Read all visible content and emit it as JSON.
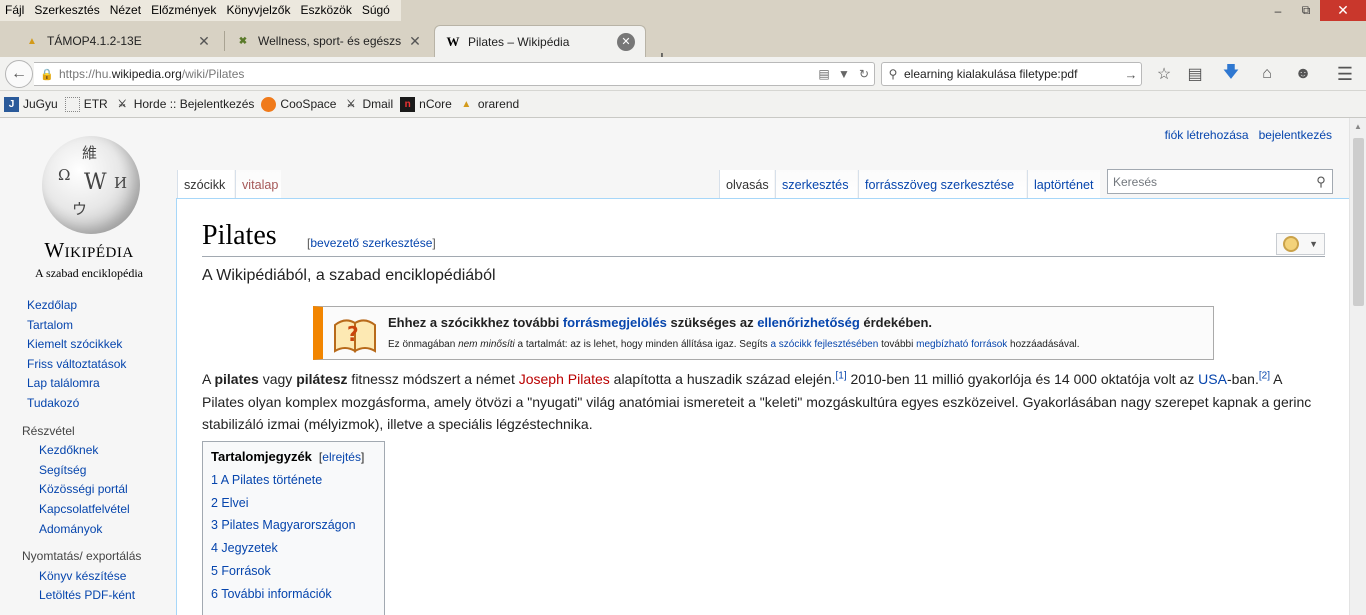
{
  "menubar": {
    "items": [
      "Fájl",
      "Szerkesztés",
      "Nézet",
      "Előzmények",
      "Könyvjelzők",
      "Eszközök",
      "Súgó"
    ]
  },
  "tabs": [
    {
      "title": "TÁMOP4.1.2-13E",
      "icon": "pma-favicon"
    },
    {
      "title": "Wellness, sport- és egészs...",
      "icon": "wellness-favicon"
    },
    {
      "title": "Pilates – Wikipédia",
      "icon": "wikipedia-favicon"
    }
  ],
  "navbar": {
    "url_prefix": "https://hu.",
    "url_domain": "wikipedia.org",
    "url_path": "/wiki/Pilates",
    "search_value": "elearning kialakulása filetype:pdf"
  },
  "bookmarks": [
    "JuGyu",
    "ETR",
    "Horde :: Bejelentkezés",
    "CooSpace",
    "Dmail",
    "nCore",
    "orarend"
  ],
  "logo": {
    "wordmark": "Wikipédia",
    "tagline": "A szabad enciklopédia",
    "glyphs": [
      "Ω",
      "W",
      "И",
      "ウ",
      "維"
    ]
  },
  "sidebar": {
    "main": [
      "Kezdőlap",
      "Tartalom",
      "Kiemelt szócikkek",
      "Friss változtatások",
      "Lap találomra",
      "Tudakozó"
    ],
    "participation_heading": "Részvétel",
    "participation": [
      "Kezdőknek",
      "Segítség",
      "Közösségi portál",
      "Kapcsolatfelvétel",
      "Adományok"
    ],
    "print_heading": "Nyomtatás/ exportálás",
    "print": [
      "Könyv készítése",
      "Letöltés PDF-ként"
    ]
  },
  "personal": {
    "create_account": "fiók létrehozása",
    "login": "bejelentkezés"
  },
  "page_tabs": {
    "article": "szócikk",
    "talk": "vitalap",
    "read": "olvasás",
    "edit": "szerkesztés",
    "edit_source": "forrásszöveg szerkesztése",
    "history": "laptörténet",
    "search_placeholder": "Keresés"
  },
  "article": {
    "title": "Pilates",
    "edit_intro": "bevezető szerkesztése",
    "site_sub": "A Wikipédiából, a szabad enciklopédiából",
    "ambox": {
      "t1": "Ehhez a szócikkhez további ",
      "t_link1": "forrásmegjelölés",
      "t2": " szükséges az ",
      "t_link2": "ellenőrizhetőség",
      "t3": " érdekében.",
      "s1": "Ez önmagában ",
      "s_em": "nem minősíti",
      "s2": " a tartalmát: az is lehet, hogy minden állítása igaz. Segíts ",
      "s_link1": "a szócikk fejlesztésében",
      "s3": " további ",
      "s_link2": "megbízható források",
      "s4": " hozzáadásával."
    },
    "lead": {
      "p1": "A ",
      "b1": "pilates",
      "p2": " vagy ",
      "b2": "pilátesz",
      "p3": " fitnessz módszert a német ",
      "person": "Joseph Pilates",
      "p4": " alapította a huszadik század elején.",
      "ref1": "[1]",
      "p5": " 2010-ben 11 millió gyakorlója és 14 000 oktatója volt az ",
      "country": "USA",
      "p6": "-ban.",
      "ref2": "[2]",
      "p7": " A Pilates olyan komplex mozgásforma, amely ötvözi a \"nyugati\" világ anatómiai ismereteit a \"keleti\" mozgáskultúra egyes eszközeivel. Gyakorlásában nagy szerepet kapnak a gerinc stabilizáló izmai (mélyizmok), illetve a speciális légzéstechnika."
    },
    "toc": {
      "title": "Tartalomjegyzék",
      "toggle": "elrejtés",
      "items": [
        "1 A Pilates története",
        "2 Elvei",
        "3 Pilates Magyarországon",
        "4 Jegyzetek",
        "5 Források",
        "6 További információk"
      ]
    }
  }
}
